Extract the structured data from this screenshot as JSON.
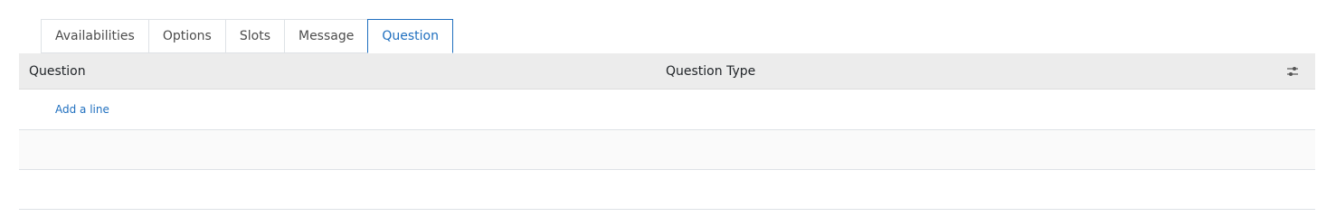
{
  "tabs": [
    {
      "label": "Availabilities",
      "active": false
    },
    {
      "label": "Options",
      "active": false
    },
    {
      "label": "Slots",
      "active": false
    },
    {
      "label": "Message",
      "active": false
    },
    {
      "label": "Question",
      "active": true
    }
  ],
  "table": {
    "columns": [
      "Question",
      "Question Type"
    ],
    "settings_icon": "sliders-icon",
    "add_line_label": "Add a line",
    "rows": []
  },
  "colors": {
    "accent": "#1f6fbf",
    "header_bg": "#ececec",
    "border": "#dee2e6"
  }
}
